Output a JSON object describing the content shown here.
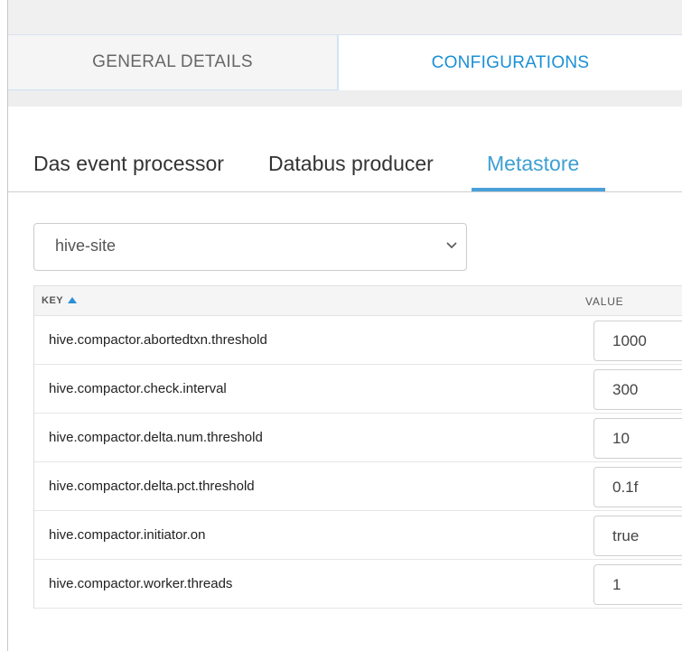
{
  "main_tabs": {
    "general_details": "GENERAL DETAILS",
    "configurations": "CONFIGURATIONS",
    "active": "configurations"
  },
  "sub_tabs": {
    "items": [
      {
        "label": "Das event processor"
      },
      {
        "label": "Databus producer"
      },
      {
        "label": "Metastore"
      }
    ],
    "active": "Metastore"
  },
  "config_select": {
    "selected": "hive-site"
  },
  "table": {
    "headers": {
      "key": "KEY",
      "value": "VALUE"
    },
    "sort": {
      "column": "KEY",
      "direction": "ascending"
    },
    "rows": [
      {
        "key": "hive.compactor.abortedtxn.threshold",
        "value": "1000"
      },
      {
        "key": "hive.compactor.check.interval",
        "value": "300"
      },
      {
        "key": "hive.compactor.delta.num.threshold",
        "value": "10"
      },
      {
        "key": "hive.compactor.delta.pct.threshold",
        "value": "0.1f"
      },
      {
        "key": "hive.compactor.initiator.on",
        "value": "true"
      },
      {
        "key": "hive.compactor.worker.threads",
        "value": "1"
      }
    ]
  },
  "icons": {
    "select": "chevron-down-icon",
    "sort": "sort-ascending-icon"
  },
  "colors": {
    "accent": "#1a8fd6",
    "active_subtab": "#3e9fd3",
    "underline": "#4aa0d8"
  }
}
